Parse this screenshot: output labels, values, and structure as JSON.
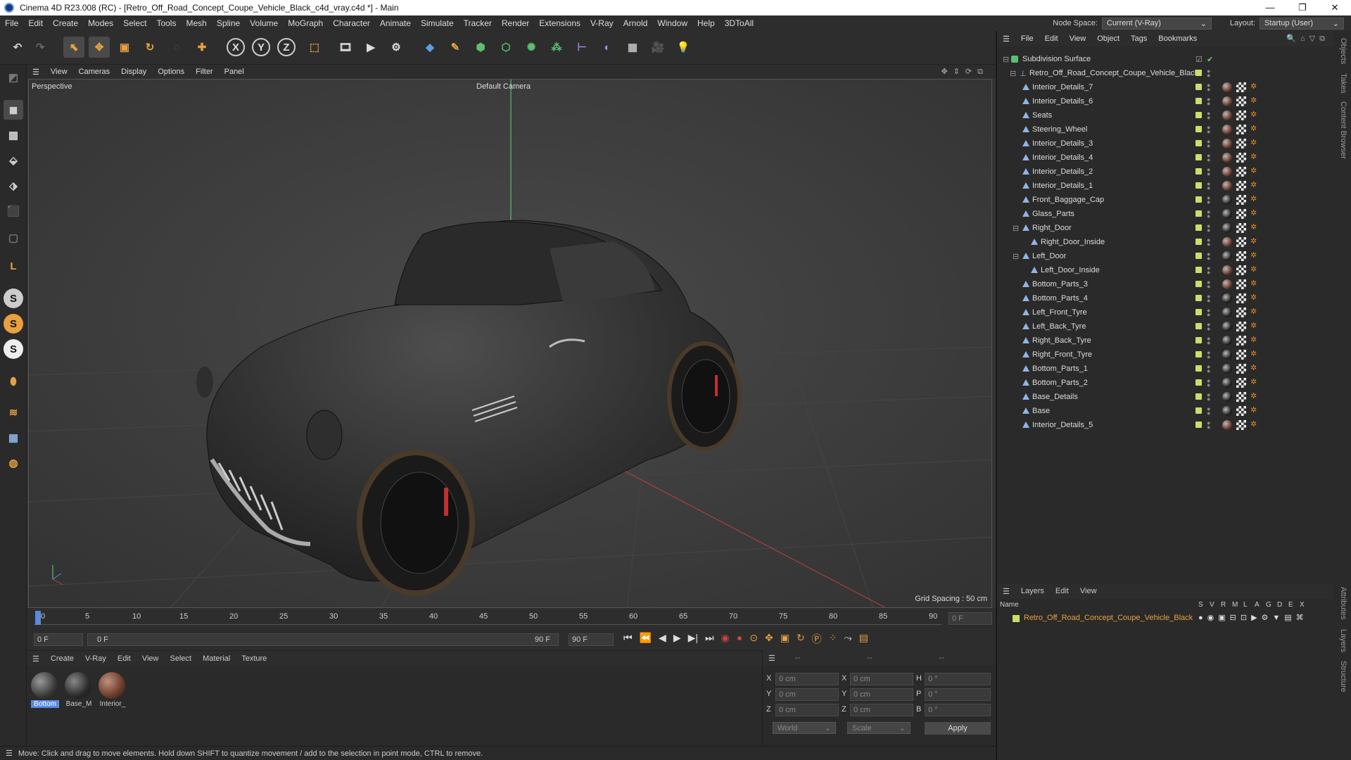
{
  "titlebar": {
    "title": "Cinema 4D R23.008 (RC) - [Retro_Off_Road_Concept_Coupe_Vehicle_Black_c4d_vray.c4d *] - Main"
  },
  "menubar": {
    "items": [
      "File",
      "Edit",
      "Create",
      "Modes",
      "Select",
      "Tools",
      "Mesh",
      "Spline",
      "Volume",
      "MoGraph",
      "Character",
      "Animate",
      "Simulate",
      "Tracker",
      "Render",
      "Extensions",
      "V-Ray",
      "Arnold",
      "Window",
      "Help",
      "3DToAll"
    ],
    "node_space_label": "Node Space:",
    "node_space_value": "Current (V-Ray)",
    "layout_label": "Layout:",
    "layout_value": "Startup (User)"
  },
  "viewport": {
    "menu": [
      "View",
      "Cameras",
      "Display",
      "Options",
      "Filter",
      "Panel"
    ],
    "label": "Perspective",
    "camera": "Default Camera",
    "grid_spacing": "Grid Spacing : 50 cm"
  },
  "timeline": {
    "ticks": [
      "0",
      "5",
      "10",
      "15",
      "20",
      "25",
      "30",
      "35",
      "40",
      "45",
      "50",
      "55",
      "60",
      "65",
      "70",
      "75",
      "80",
      "85",
      "90"
    ],
    "current_frame_right": "0 F",
    "start_frame": "0 F",
    "range_start": "0 F",
    "range_end": "90 F",
    "end_frame": "90 F"
  },
  "materials": {
    "menu": [
      "Create",
      "V-Ray",
      "Edit",
      "View",
      "Select",
      "Material",
      "Texture"
    ],
    "items": [
      {
        "label": "Bottom",
        "color": "#3a3a3a"
      },
      {
        "label": "Base_M",
        "color": "#2a2a2a"
      },
      {
        "label": "Interior_",
        "color": "#6a3a2a"
      }
    ]
  },
  "coords": {
    "header": [
      "--",
      "--",
      "--"
    ],
    "rows": [
      {
        "a": "X",
        "av": "0 cm",
        "b": "X",
        "bv": "0 cm",
        "c": "H",
        "cv": "0 °"
      },
      {
        "a": "Y",
        "av": "0 cm",
        "b": "Y",
        "bv": "0 cm",
        "c": "P",
        "cv": "0 °"
      },
      {
        "a": "Z",
        "av": "0 cm",
        "b": "Z",
        "bv": "0 cm",
        "c": "B",
        "cv": "0 °"
      }
    ],
    "world": "World",
    "scale": "Scale",
    "apply": "Apply"
  },
  "status": {
    "text": "Move: Click and drag to move elements. Hold down SHIFT to quantize movement / add to the selection in point mode, CTRL to remove."
  },
  "objects": {
    "menu": [
      "File",
      "Edit",
      "View",
      "Object",
      "Tags",
      "Bookmarks"
    ],
    "root": "Subdivision Surface",
    "group": "Retro_Off_Road_Concept_Coupe_Vehicle_Black",
    "items": [
      {
        "name": "Interior_Details_7",
        "indent": 0,
        "mat": "#6a3a2a"
      },
      {
        "name": "Interior_Details_6",
        "indent": 0,
        "mat": "#6a3a2a"
      },
      {
        "name": "Seats",
        "indent": 0,
        "mat": "#6a3a2a"
      },
      {
        "name": "Steering_Wheel",
        "indent": 0,
        "mat": "#6a3a2a"
      },
      {
        "name": "Interior_Details_3",
        "indent": 0,
        "mat": "#6a3a2a"
      },
      {
        "name": "Interior_Details_4",
        "indent": 0,
        "mat": "#6a3a2a"
      },
      {
        "name": "Interior_Details_2",
        "indent": 0,
        "mat": "#6a3a2a"
      },
      {
        "name": "Interior_Details_1",
        "indent": 0,
        "mat": "#6a3a2a"
      },
      {
        "name": "Front_Baggage_Cap",
        "indent": 0,
        "mat": "#222222"
      },
      {
        "name": "Glass_Parts",
        "indent": 0,
        "mat": "#222222"
      },
      {
        "name": "Right_Door",
        "indent": 0,
        "mat": "#222222"
      },
      {
        "name": "Right_Door_Inside",
        "indent": 1,
        "mat": "#6a3a2a"
      },
      {
        "name": "Left_Door",
        "indent": 0,
        "mat": "#222222"
      },
      {
        "name": "Left_Door_Inside",
        "indent": 1,
        "mat": "#6a3a2a"
      },
      {
        "name": "Bottom_Parts_3",
        "indent": 0,
        "mat": "#6a3a2a"
      },
      {
        "name": "Bottom_Parts_4",
        "indent": 0,
        "mat": "#222222"
      },
      {
        "name": "Left_Front_Tyre",
        "indent": 0,
        "mat": "#222222"
      },
      {
        "name": "Left_Back_Tyre",
        "indent": 0,
        "mat": "#222222"
      },
      {
        "name": "Right_Back_Tyre",
        "indent": 0,
        "mat": "#222222"
      },
      {
        "name": "Right_Front_Tyre",
        "indent": 0,
        "mat": "#222222"
      },
      {
        "name": "Bottom_Parts_1",
        "indent": 0,
        "mat": "#222222"
      },
      {
        "name": "Bottom_Parts_2",
        "indent": 0,
        "mat": "#222222"
      },
      {
        "name": "Base_Details",
        "indent": 0,
        "mat": "#222222"
      },
      {
        "name": "Base",
        "indent": 0,
        "mat": "#222222"
      },
      {
        "name": "Interior_Details_5",
        "indent": 0,
        "mat": "#6a3a2a"
      }
    ]
  },
  "layers": {
    "menu": [
      "Layers",
      "Edit",
      "View"
    ],
    "col_name": "Name",
    "cols": [
      "S",
      "V",
      "R",
      "M",
      "L",
      "A",
      "G",
      "D",
      "E",
      "X"
    ],
    "row": "Retro_Off_Road_Concept_Coupe_Vehicle_Black"
  },
  "sidetabs": [
    "Objects",
    "Takes",
    "Content Browser",
    "Attributes",
    "Layers",
    "Structure"
  ]
}
